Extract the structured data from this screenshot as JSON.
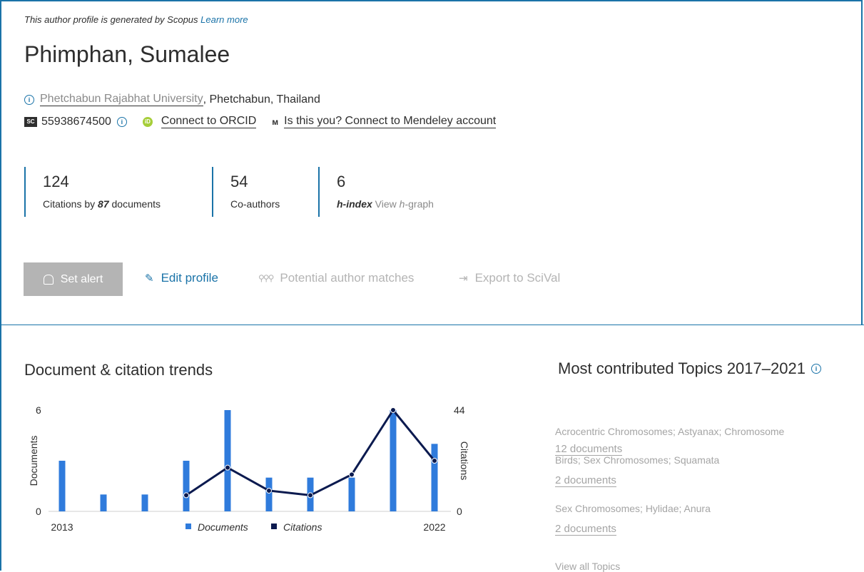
{
  "colors": {
    "accent": "#1a73a8",
    "bar": "#2f7bdc",
    "line": "#0b1a4f",
    "muted": "#b4b4b4"
  },
  "header": {
    "notice_text": "This author profile is generated by Scopus",
    "notice_link": "Learn more",
    "author_name": "Phimphan, Sumalee",
    "affiliation_link": "Phetchabun Rajabhat University",
    "affiliation_rest": ", Phetchabun, Thailand",
    "scopus_badge": "SC",
    "author_id": "55938674500",
    "orcid_label": "Connect to ORCID",
    "mendeley_label": "Is this you? Connect to Mendeley account"
  },
  "metrics": {
    "citations": {
      "value": "124",
      "label_prefix": "Citations by ",
      "label_bold": "87",
      "label_suffix": " documents"
    },
    "coauthors": {
      "value": "54",
      "label": "Co-authors"
    },
    "hindex": {
      "value": "6",
      "label": "h-index",
      "link_text": "View ",
      "link_italic": "h",
      "link_suffix": "-graph"
    }
  },
  "actions": {
    "set_alert": "Set alert",
    "edit_profile": "Edit profile",
    "potential_matches": "Potential author matches",
    "export_scival": "Export to SciVal"
  },
  "trends": {
    "title": "Document & citation trends"
  },
  "chart_data": {
    "type": "bar",
    "x": [
      2013,
      2014,
      2015,
      2016,
      2017,
      2018,
      2019,
      2020,
      2021,
      2022
    ],
    "xtick_labels": [
      "2013",
      "2022"
    ],
    "series": [
      {
        "name": "Documents",
        "type": "bar",
        "axis": "left",
        "values": [
          3,
          1,
          1,
          3,
          6,
          2,
          2,
          2,
          6,
          4
        ]
      },
      {
        "name": "Citations",
        "type": "line",
        "axis": "right",
        "values": [
          null,
          null,
          null,
          7,
          19,
          9,
          7,
          16,
          44,
          22
        ]
      }
    ],
    "ylabel_left": "Documents",
    "ylim_left": [
      0,
      6
    ],
    "yticks_left": [
      "0",
      "6"
    ],
    "ylabel_right": "Citations",
    "ylim_right": [
      0,
      44
    ],
    "yticks_right": [
      "0",
      "44"
    ],
    "legend_position": "bottom-center"
  },
  "topics": {
    "title": "Most contributed Topics 2017–2021",
    "items": [
      {
        "name": "Acrocentric Chromosomes; Astyanax; Chromosome",
        "docs": "12 documents"
      },
      {
        "name": "Birds; Sex Chromosomes; Squamata",
        "docs": "2 documents"
      },
      {
        "name": "Sex Chromosomes; Hylidae; Anura",
        "docs": "2 documents"
      }
    ],
    "view_all": "View all Topics"
  }
}
